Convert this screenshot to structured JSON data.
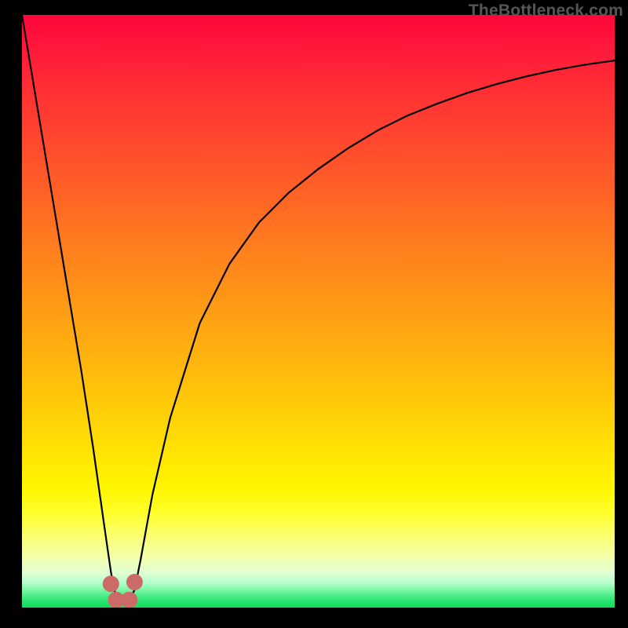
{
  "watermark": "TheBottleneck.com",
  "chart_data": {
    "type": "line",
    "title": "",
    "xlabel": "",
    "ylabel": "",
    "xlim": [
      0,
      100
    ],
    "ylim": [
      0,
      100
    ],
    "grid": false,
    "legend": false,
    "series": [
      {
        "name": "bottleneck-curve",
        "x": [
          0,
          2,
          4,
          6,
          8,
          10,
          12,
          14,
          15,
          16,
          17,
          18,
          19,
          20,
          22,
          25,
          30,
          35,
          40,
          45,
          50,
          55,
          60,
          65,
          70,
          75,
          80,
          85,
          90,
          95,
          100
        ],
        "y": [
          100,
          88,
          76,
          64,
          52,
          40,
          27,
          13,
          6,
          1,
          1,
          1,
          3,
          8,
          19,
          32,
          48,
          58,
          65,
          70,
          74,
          77.5,
          80.5,
          83,
          85,
          86.8,
          88.3,
          89.6,
          90.7,
          91.6,
          92.3
        ]
      }
    ],
    "markers": [
      {
        "name": "marker-left-outer",
        "x": 15.0,
        "y": 4.0
      },
      {
        "name": "marker-left-inner",
        "x": 15.9,
        "y": 1.3
      },
      {
        "name": "marker-right-inner",
        "x": 18.1,
        "y": 1.3
      },
      {
        "name": "marker-right-outer",
        "x": 19.0,
        "y": 4.3
      }
    ],
    "marker_color": "#cc6a68",
    "curve_color": "#000000",
    "background_gradient": {
      "top": "#ff063b",
      "mid": "#fff600",
      "bottom": "#12db60"
    }
  }
}
